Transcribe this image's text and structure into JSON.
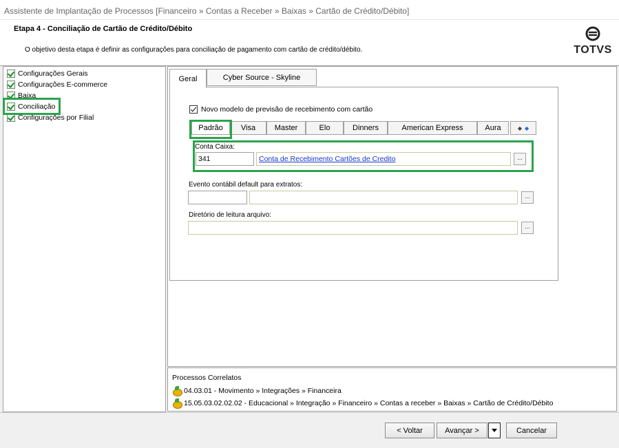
{
  "window": {
    "title": "Assistente de Implantação de Processos [Financeiro » Contas a Receber » Baixas » Cartão de Crédito/Débito]"
  },
  "header": {
    "step_title": "Etapa 4 - Conciliação de Cartão de Crédito/Débito",
    "description": "O objetivo desta etapa é definir as configurações para conciliação de pagamento com cartão de crédito/débito.",
    "logo_text": "TOTVS",
    "logo_icon": "totvs-logo-icon"
  },
  "tree": {
    "items": [
      {
        "label": "Configurações Gerais"
      },
      {
        "label": "Configurações E-commerce"
      },
      {
        "label": "Baixa"
      },
      {
        "label": "Conciliação"
      },
      {
        "label": "Configurações por Filial"
      }
    ],
    "highlight_color": "#2aa44c"
  },
  "main": {
    "tabs": [
      {
        "label": "Geral"
      },
      {
        "label": "Cyber Source - Skyline"
      }
    ],
    "checkbox_label": "Novo modelo de previsão de recebimento com cartão",
    "card_tabs": [
      {
        "label": "Padrão"
      },
      {
        "label": "Visa"
      },
      {
        "label": "Master"
      },
      {
        "label": "Elo"
      },
      {
        "label": "Dinners"
      },
      {
        "label": "American Express"
      },
      {
        "label": "Aura"
      }
    ],
    "conta_caixa": {
      "label": "Conta Caixa:",
      "code": "341",
      "description": "Conta de Recebimento Cartões de Credito",
      "button": "..."
    },
    "evento": {
      "label": "Evento contábil default para extratos:",
      "code": "",
      "description": "",
      "button": "..."
    },
    "diretorio": {
      "label": "Diretório de leitura arquivo:",
      "value": "",
      "button": "..."
    }
  },
  "processos": {
    "title": "Processos Correlatos",
    "items": [
      {
        "text": "04.03.01 - Movimento » Integrações » Financeira"
      },
      {
        "text": "15.05.03.02.02.02 - Educacional » Integração » Financeiro » Contas a receber » Baixas » Cartão de Crédito/Débito"
      }
    ]
  },
  "footer": {
    "voltar": "< Voltar",
    "avancar": "Avançar >",
    "cancelar": "Cancelar"
  }
}
